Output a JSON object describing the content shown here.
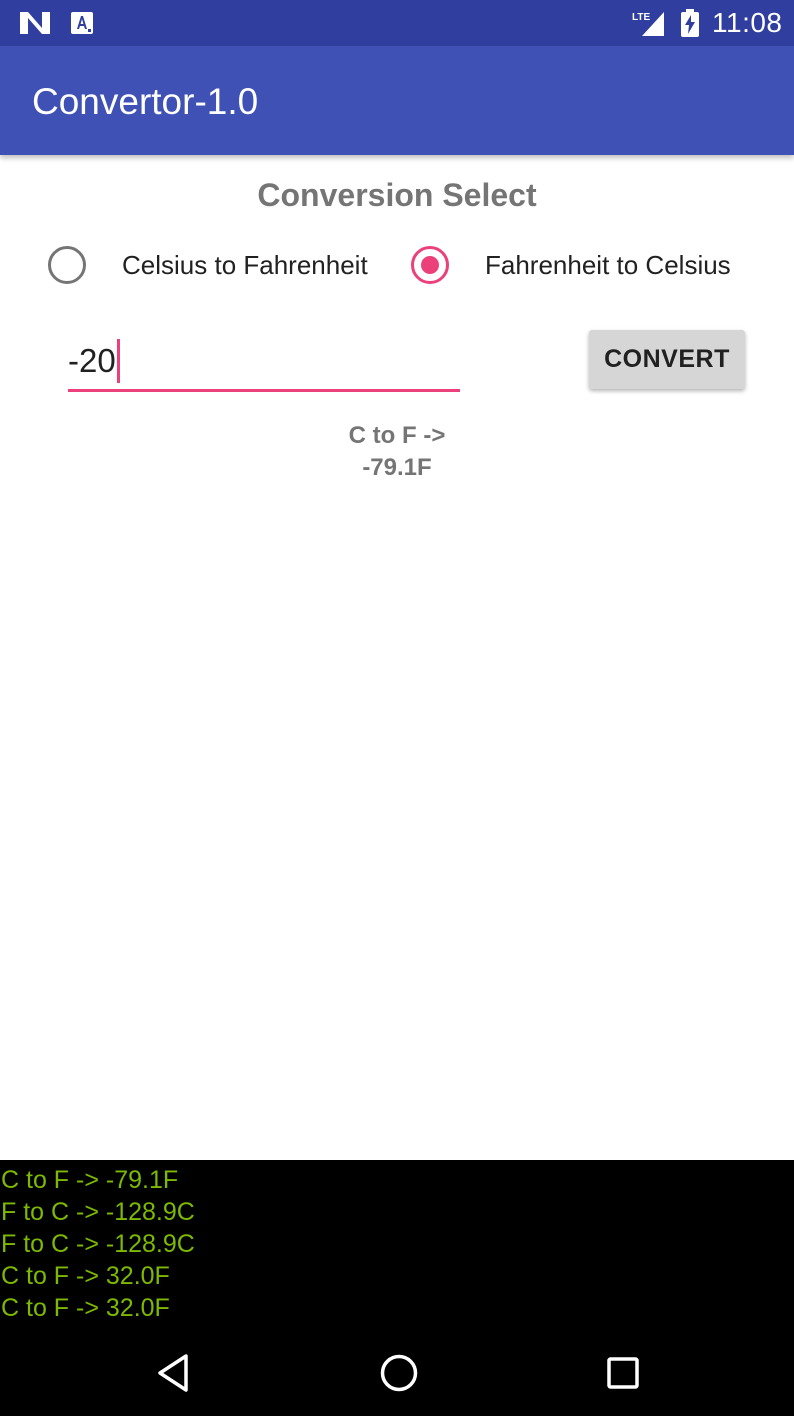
{
  "status_bar": {
    "time": "11:08",
    "network_label": "LTE",
    "icons": [
      "notification-n-icon",
      "notification-a-icon",
      "lte-signal-icon",
      "battery-charging-icon"
    ]
  },
  "app_bar": {
    "title": "Convertor-1.0"
  },
  "conversion": {
    "section_title": "Conversion Select",
    "options": [
      {
        "label": "Celsius to Fahrenheit",
        "checked": false
      },
      {
        "label": "Fahrenheit to Celsius",
        "checked": true
      }
    ],
    "input_value": "-20",
    "convert_label": "CONVERT",
    "result_line1": "C to F ->",
    "result_line2": "-79.1F"
  },
  "log": {
    "lines": [
      "C to F -> -79.1F",
      "F to C -> -128.9C",
      "F to C -> -128.9C",
      "C to F -> 32.0F",
      "C to F -> 32.0F"
    ]
  },
  "nav_bar": {
    "icons": [
      "back-icon",
      "home-icon",
      "recents-icon"
    ]
  },
  "colors": {
    "primary": "#3f51b5",
    "primary_dark": "#303f9f",
    "accent": "#ec407a",
    "log_text": "#7cb900"
  }
}
